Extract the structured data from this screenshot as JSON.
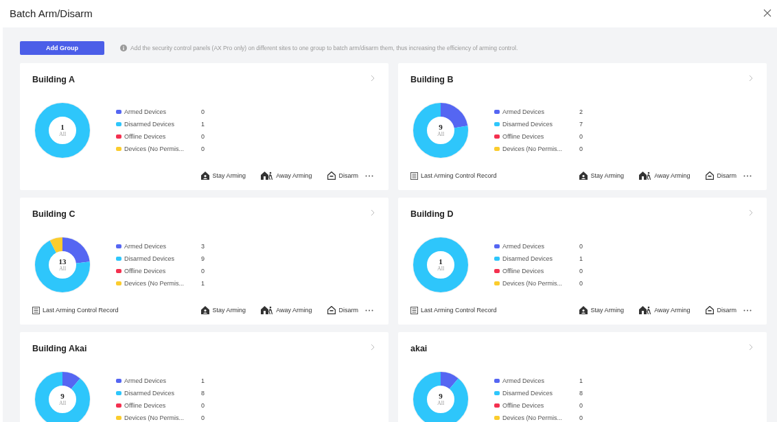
{
  "dialog": {
    "title": "Batch Arm/Disarm"
  },
  "toolbar": {
    "add_button": "Add Group",
    "hint": "Add the security control panels (AX Pro only) on different sites to one group to batch arm/disarm them, thus increasing the efficiency of arming control."
  },
  "groups": [
    {
      "name": "Building A",
      "total": "1",
      "total_label": "All",
      "stats": [
        {
          "label": "Armed Devices",
          "count": "0",
          "color": "#5566f2"
        },
        {
          "label": "Disarmed Devices",
          "count": "1",
          "color": "#2ec6fb"
        },
        {
          "label": "Offline Devices",
          "count": "0",
          "color": "#f4304f"
        },
        {
          "label": "Devices (No Permis...",
          "count": "0",
          "color": "#fbcc2d"
        }
      ],
      "actions": [
        "Stay Arming",
        "Away Arming",
        "Disarm"
      ]
    },
    {
      "name": "Building B",
      "total": "9",
      "total_label": "All",
      "stats": [
        {
          "label": "Armed Devices",
          "count": "2",
          "color": "#5566f2"
        },
        {
          "label": "Disarmed Devices",
          "count": "7",
          "color": "#2ec6fb"
        },
        {
          "label": "Offline Devices",
          "count": "0",
          "color": "#f4304f"
        },
        {
          "label": "Devices (No Permis...",
          "count": "0",
          "color": "#fbcc2d"
        }
      ],
      "record": "Last Arming Control Record",
      "actions": [
        "Stay Arming",
        "Away Arming",
        "Disarm"
      ]
    },
    {
      "name": "Building C",
      "total": "13",
      "total_label": "All",
      "stats": [
        {
          "label": "Armed Devices",
          "count": "3",
          "color": "#5566f2"
        },
        {
          "label": "Disarmed Devices",
          "count": "9",
          "color": "#2ec6fb"
        },
        {
          "label": "Offline Devices",
          "count": "0",
          "color": "#f4304f"
        },
        {
          "label": "Devices (No Permis...",
          "count": "1",
          "color": "#fbcc2d"
        }
      ],
      "record": "Last Arming Control Record",
      "actions": [
        "Stay Arming",
        "Away Arming",
        "Disarm"
      ]
    },
    {
      "name": "Building D",
      "total": "1",
      "total_label": "All",
      "stats": [
        {
          "label": "Armed Devices",
          "count": "0",
          "color": "#5566f2"
        },
        {
          "label": "Disarmed Devices",
          "count": "1",
          "color": "#2ec6fb"
        },
        {
          "label": "Offline Devices",
          "count": "0",
          "color": "#f4304f"
        },
        {
          "label": "Devices (No Permis...",
          "count": "0",
          "color": "#fbcc2d"
        }
      ],
      "record": "Last Arming Control Record",
      "actions": [
        "Stay Arming",
        "Away Arming",
        "Disarm"
      ]
    },
    {
      "name": "Building Akai",
      "total": "9",
      "total_label": "All",
      "stats": [
        {
          "label": "Armed Devices",
          "count": "1",
          "color": "#5566f2"
        },
        {
          "label": "Disarmed Devices",
          "count": "8",
          "color": "#2ec6fb"
        },
        {
          "label": "Offline Devices",
          "count": "0",
          "color": "#f4304f"
        },
        {
          "label": "Devices (No Permis...",
          "count": "0",
          "color": "#fbcc2d"
        }
      ]
    },
    {
      "name": "akai",
      "total": "9",
      "total_label": "All",
      "stats": [
        {
          "label": "Armed Devices",
          "count": "1",
          "color": "#5566f2"
        },
        {
          "label": "Disarmed Devices",
          "count": "8",
          "color": "#2ec6fb"
        },
        {
          "label": "Offline Devices",
          "count": "0",
          "color": "#f4304f"
        },
        {
          "label": "Devices (No Permis...",
          "count": "0",
          "color": "#fbcc2d"
        }
      ]
    }
  ]
}
